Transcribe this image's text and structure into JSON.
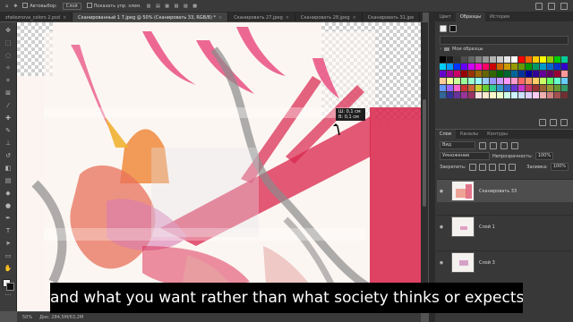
{
  "options_bar": {
    "auto_select_label": "Автовыбор:",
    "auto_select_value": "Слой",
    "show_controls_label": "Показать упр. элем."
  },
  "tabs": [
    {
      "label": "zheleznova_colors 2.psd",
      "active": false
    },
    {
      "label": "Сканированный 1 7.jpeg @ 50% (Сканировать 33, RGB/8) *",
      "active": true
    },
    {
      "label": "Сканировать 27.jpeg",
      "active": false
    },
    {
      "label": "Сканировать 28.jpeg",
      "active": false
    },
    {
      "label": "Сканировать 31.jpe",
      "active": false
    }
  ],
  "tab_close_glyph": "×",
  "transform_tooltip": {
    "x_line": "Ш: 0,1 см",
    "y_line": "В: 0,1 см"
  },
  "subtitle": "and what you want rather than what society thinks or expects of you.",
  "status": {
    "zoom": "50%",
    "doc_size": "Док: 284,5M/63,2M"
  },
  "swatches_panel": {
    "tabs": [
      {
        "label": "Цвет",
        "active": false
      },
      {
        "label": "Образцы",
        "active": true
      },
      {
        "label": "История",
        "active": false
      }
    ],
    "folder_label": "Мои образцы",
    "colors": [
      "#000000",
      "#1a1a1a",
      "#333333",
      "#4d4d4d",
      "#666666",
      "#808080",
      "#999999",
      "#b3b3b3",
      "#cccccc",
      "#e6e6e6",
      "#ffffff",
      "#ff0000",
      "#ff6600",
      "#ffcc00",
      "#ffff00",
      "#99cc00",
      "#00cc00",
      "#00cc99",
      "#00ccff",
      "#0099ff",
      "#0033ff",
      "#6600ff",
      "#cc00ff",
      "#ff00cc",
      "#ff0066",
      "#cc0000",
      "#cc6600",
      "#cc9900",
      "#999900",
      "#669900",
      "#009900",
      "#009966",
      "#0099cc",
      "#0066cc",
      "#0033cc",
      "#3300cc",
      "#6600cc",
      "#990099",
      "#cc0066",
      "#990000",
      "#993300",
      "#996600",
      "#666600",
      "#336600",
      "#006600",
      "#006633",
      "#006699",
      "#003399",
      "#000099",
      "#330099",
      "#660099",
      "#660066",
      "#990033",
      "#ff9999",
      "#ffcc99",
      "#ffff99",
      "#ccff99",
      "#99ff99",
      "#99ffcc",
      "#99ffff",
      "#99ccff",
      "#9999ff",
      "#cc99ff",
      "#ff99ff",
      "#ff99cc",
      "#ff6666",
      "#ff9966",
      "#ffcc66",
      "#ccff66",
      "#66ff66",
      "#66ffcc",
      "#66ccff",
      "#6699ff",
      "#9966ff",
      "#ff66cc",
      "#cc3333",
      "#cc6633",
      "#cccc33",
      "#66cc33",
      "#33cc99",
      "#3399cc",
      "#3366cc",
      "#6633cc",
      "#cc33cc",
      "#cc3366",
      "#993333",
      "#996633",
      "#999933",
      "#669933",
      "#339966",
      "#336699",
      "#333399",
      "#663399",
      "#993399",
      "#993366",
      "#ffe0e0",
      "#ffe8cc",
      "#fffacc",
      "#e8ffcc",
      "#ccffe8",
      "#ccf2ff",
      "#cce0ff",
      "#e0ccff",
      "#ffccf2",
      "#f0b0b0",
      "#d08080",
      "#a05050",
      "#703030"
    ]
  },
  "layers_panel": {
    "tabs": [
      {
        "label": "Слои",
        "active": true
      },
      {
        "label": "Каналы",
        "active": false
      },
      {
        "label": "Контуры",
        "active": false
      }
    ],
    "kind_filter": "Вид",
    "blend_mode": "Умножение",
    "opacity_label": "Непрозрачность:",
    "opacity_value": "100%",
    "lock_label": "Закрепить:",
    "fill_label": "Заливка:",
    "fill_value": "100%",
    "layers": [
      {
        "name": "Сканировать 33",
        "visible": true,
        "selected": true
      },
      {
        "name": "Слой 1",
        "visible": true,
        "selected": false
      },
      {
        "name": "Слой 3",
        "visible": true,
        "selected": false
      }
    ]
  },
  "colors": {
    "accent_red": "#d9234b",
    "panel_bg": "#383838",
    "selected_layer": "#4d4d4d"
  }
}
